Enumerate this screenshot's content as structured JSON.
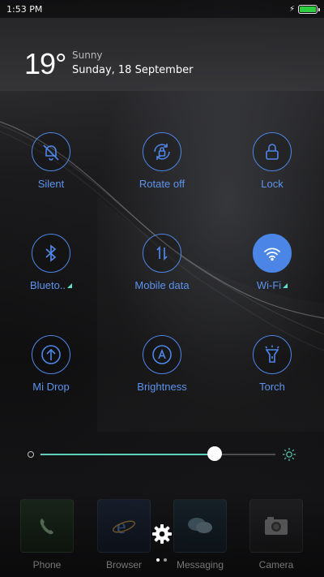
{
  "status_bar": {
    "time": "1:53 PM",
    "battery_level": 1.0,
    "battery_color": "#2ecc40",
    "charging_icon": "bolt-icon"
  },
  "header": {
    "temperature": "19°",
    "condition": "Sunny",
    "date": "Sunday, 18 September"
  },
  "toggles": [
    {
      "id": "silent",
      "label": "Silent",
      "icon": "bell-off-icon",
      "active": false
    },
    {
      "id": "rotate",
      "label": "Rotate off",
      "icon": "rotate-lock-icon",
      "active": false
    },
    {
      "id": "lock",
      "label": "Lock",
      "icon": "padlock-icon",
      "active": false
    },
    {
      "id": "bluetooth",
      "label": "Blueto..",
      "icon": "bluetooth-icon",
      "active": false,
      "has_menu": true
    },
    {
      "id": "mobile_data",
      "label": "Mobile data",
      "icon": "data-arrows-icon",
      "active": false
    },
    {
      "id": "wifi",
      "label": "Wi-Fi",
      "icon": "wifi-icon",
      "active": true,
      "has_menu": true
    },
    {
      "id": "mi_drop",
      "label": "Mi Drop",
      "icon": "upload-arrow-icon",
      "active": false
    },
    {
      "id": "brightness",
      "label": "Brightness",
      "icon": "auto-brightness-icon",
      "active": false
    },
    {
      "id": "torch",
      "label": "Torch",
      "icon": "flashlight-icon",
      "active": false
    }
  ],
  "brightness_slider": {
    "level": 0.74,
    "track_color": "#5fd0b8"
  },
  "dock": {
    "apps": [
      {
        "name": "Phone",
        "icon": "phone-icon"
      },
      {
        "name": "Browser",
        "icon": "browser-icon"
      },
      {
        "name": "Messaging",
        "icon": "messaging-icon"
      },
      {
        "name": "Camera",
        "icon": "camera-icon"
      }
    ],
    "settings_icon": "gear-icon"
  },
  "colors": {
    "accent": "#4f86e8",
    "active_fill": "#4b86e6",
    "label": "#5d93ee",
    "menu_indicator": "#5fe0c8"
  }
}
